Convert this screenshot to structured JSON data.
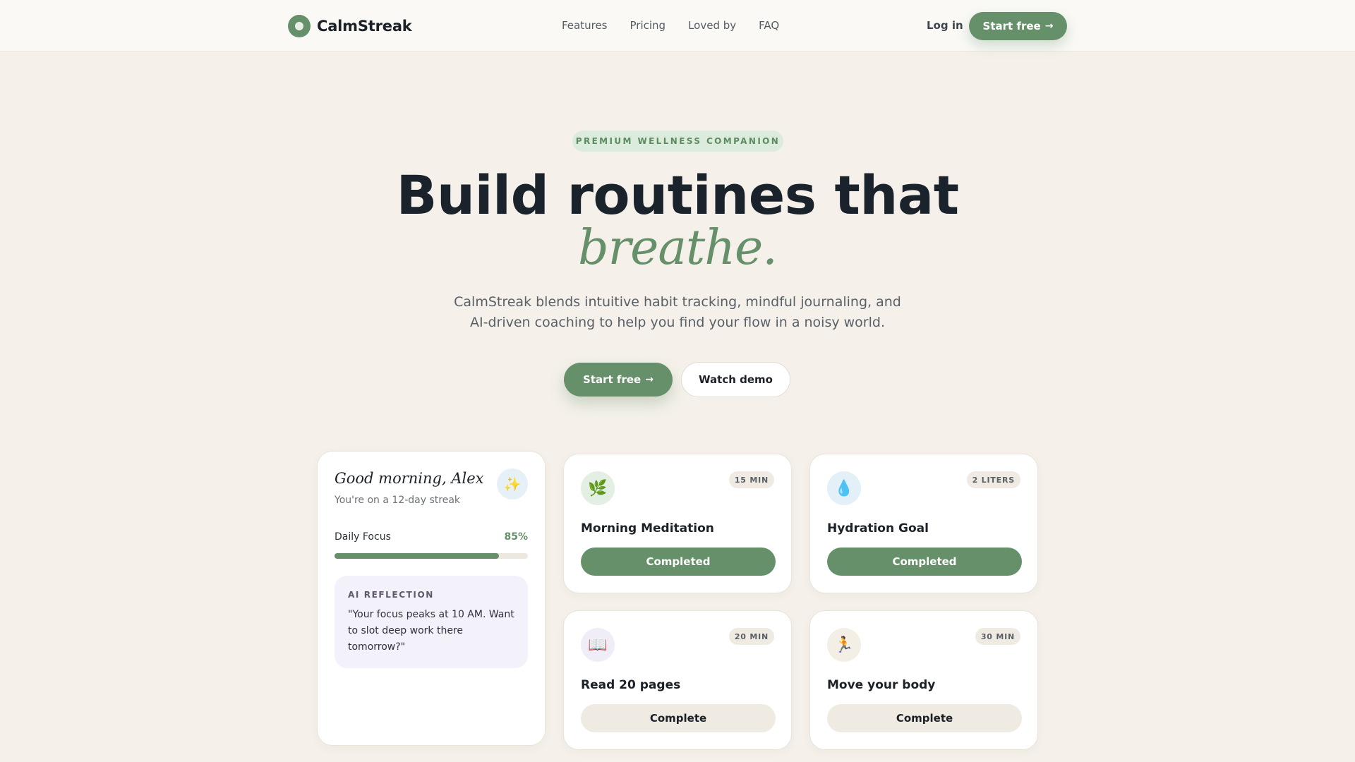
{
  "nav": {
    "brand": "CalmStreak",
    "links": [
      "Features",
      "Pricing",
      "Loved by",
      "FAQ"
    ],
    "login": "Log in",
    "cta": "Start free"
  },
  "hero": {
    "badge": "PREMIUM WELLNESS COMPANION",
    "title": "Build routines that",
    "title_accent": "breathe.",
    "subtitle": "CalmStreak blends intuitive habit tracking, mindful journaling, and AI-driven coaching to help you find your flow in a noisy world.",
    "primary_cta": "Start free",
    "secondary_cta": "Watch demo"
  },
  "dashboard": {
    "greeting": "Good morning, Alex",
    "streak": "You're on a 12-day streak",
    "focus_label": "Daily Focus",
    "focus_value": "85%",
    "focus_fraction": 0.85,
    "reflection_label": "AI REFLECTION",
    "reflection_text": "\"Your focus peaks at 10 AM. Want to slot deep work there tomorrow?\""
  },
  "habits": [
    {
      "title": "Morning Meditation",
      "tag": "15 MIN",
      "icon": "leaf-icon",
      "glyph": "🌿",
      "icon_bg": "#e4efe3",
      "button": "Completed",
      "done": true
    },
    {
      "title": "Hydration Goal",
      "tag": "2 LITERS",
      "icon": "water-drop-icon",
      "glyph": "💧",
      "icon_bg": "#e3f0f7",
      "button": "Completed",
      "done": true
    },
    {
      "title": "Read 20 pages",
      "tag": "20 MIN",
      "icon": "book-icon",
      "glyph": "📖",
      "icon_bg": "#f0ecf8",
      "button": "Complete",
      "done": false
    },
    {
      "title": "Move your body",
      "tag": "30 MIN",
      "icon": "runner-icon",
      "glyph": "🏃",
      "icon_bg": "#f3efe6",
      "button": "Complete",
      "done": false
    }
  ],
  "colors": {
    "accent": "#66906a",
    "background": "#f5f1ea",
    "heading": "#1a222b"
  }
}
